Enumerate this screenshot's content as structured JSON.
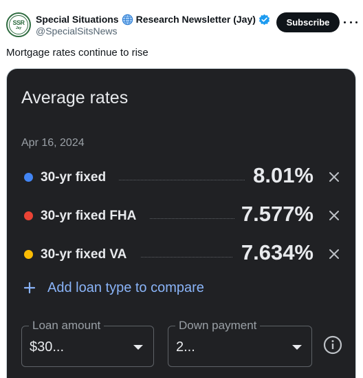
{
  "tweet": {
    "author_part1": "Special Situations",
    "author_part2": "Research Newsletter (Jay)",
    "handle": "@SpecialSitsNews",
    "subscribe_label": "Subscribe",
    "text": "Mortgage rates continue to rise",
    "avatar_monogram": "SSR",
    "avatar_sub": "Jay"
  },
  "card": {
    "title": "Average rates",
    "date": "Apr 16, 2024",
    "rates": [
      {
        "label": "30-yr fixed",
        "value": "8.01%",
        "color": "#4285f4"
      },
      {
        "label": "30-yr fixed FHA",
        "value": "7.577%",
        "color": "#ea4335"
      },
      {
        "label": "30-yr fixed VA",
        "value": "7.634%",
        "color": "#fbbc04"
      }
    ],
    "add_loan_label": "Add loan type to compare",
    "loan_amount": {
      "label": "Loan amount",
      "value": "$30..."
    },
    "down_payment": {
      "label": "Down payment",
      "value": "2..."
    }
  },
  "colors": {
    "accent": "#8ab4f8",
    "card_background": "#202124",
    "verified": "#1d9bf0"
  },
  "icons": [
    "globe-icon",
    "verified-icon",
    "more-icon",
    "remove-icon",
    "plus-icon",
    "caret-down-icon",
    "info-icon"
  ]
}
